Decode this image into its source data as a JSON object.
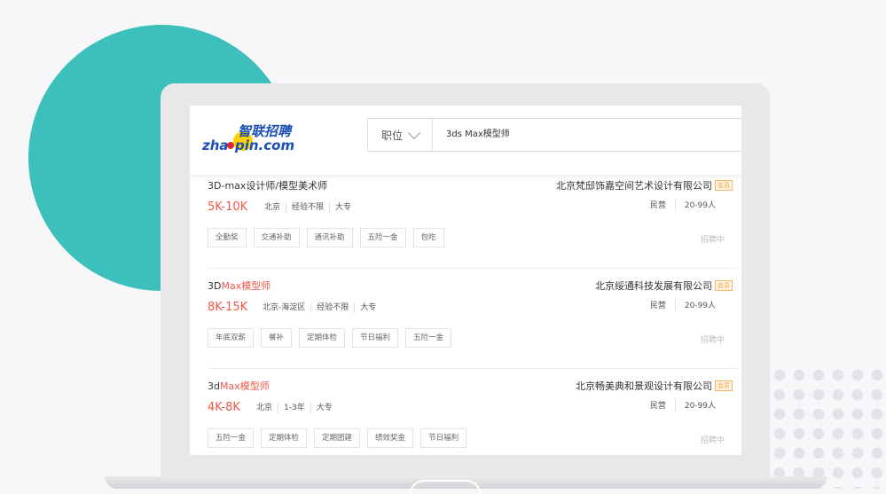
{
  "logo": {
    "pinyin": "zhaopin.com",
    "cn": "智联招聘"
  },
  "search": {
    "type_label": "职位",
    "query": "3ds Max模型师"
  },
  "jobs": [
    {
      "title_pre": "3D-max设计师/模型美术师",
      "title_hl": "",
      "salary": "5K-10K",
      "meta": [
        "北京",
        "经验不限",
        "大专"
      ],
      "tags": [
        "全勤奖",
        "交通补助",
        "通讯补助",
        "五险一金",
        "包吃"
      ],
      "company": "北京梵邸饰嘉空间艺术设计有限公司",
      "vip": "会员",
      "company_type": "民营",
      "company_size": "20-99人",
      "status": "招聘中"
    },
    {
      "title_pre": "3D",
      "title_hl": "Max模型师",
      "salary": "8K-15K",
      "meta": [
        "北京-海淀区",
        "经验不限",
        "大专"
      ],
      "tags": [
        "年底双薪",
        "餐补",
        "定期体检",
        "节日福利",
        "五险一金"
      ],
      "company": "北京绥通科技发展有限公司",
      "vip": "会员",
      "company_type": "民营",
      "company_size": "20-99人",
      "status": "招聘中"
    },
    {
      "title_pre": "3d",
      "title_hl": "Max模型师",
      "salary": "4K-8K",
      "meta": [
        "北京",
        "1-3年",
        "大专"
      ],
      "tags": [
        "五险一金",
        "定期体检",
        "定期团建",
        "绩效奖金",
        "节日福利"
      ],
      "company": "北京畅美典和景观设计有限公司",
      "vip": "会员",
      "company_type": "民营",
      "company_size": "20-99人",
      "status": "招聘中"
    }
  ],
  "colors": {
    "accent": "#f0574a",
    "teal": "#3dbfbb",
    "logo_blue": "#1a4fb5",
    "logo_yellow": "#ffd200"
  }
}
